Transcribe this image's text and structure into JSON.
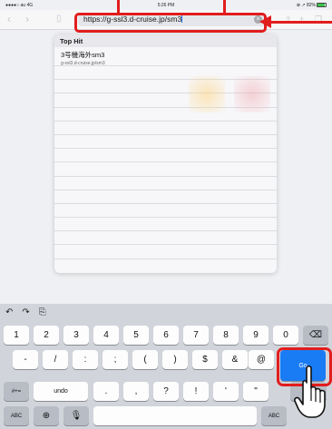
{
  "status": {
    "carrier": "●●●●○ au 4G",
    "time": "5:26 PM",
    "battery": "⊕ ↗ 82%"
  },
  "browser": {
    "url": "https://g-ssl3.d-cruise.jp/sm3"
  },
  "suggestions": {
    "header": "Top Hit",
    "top_hit": {
      "title": "3号機海外sm3",
      "url": "g-ssl3.d-cruise.jp/sm3"
    }
  },
  "keyboard": {
    "row1": [
      "1",
      "2",
      "3",
      "4",
      "5",
      "6",
      "7",
      "8",
      "9",
      "0"
    ],
    "row2": [
      "-",
      "/",
      ":",
      ";",
      "(",
      ")",
      "$",
      "&",
      "@"
    ],
    "go_label": "Go",
    "row3": [
      ".",
      ",",
      "?",
      "!",
      "'",
      "\""
    ],
    "undo_label": "undo",
    "symbol_label": "#+=",
    "abc_label": "ABC"
  }
}
